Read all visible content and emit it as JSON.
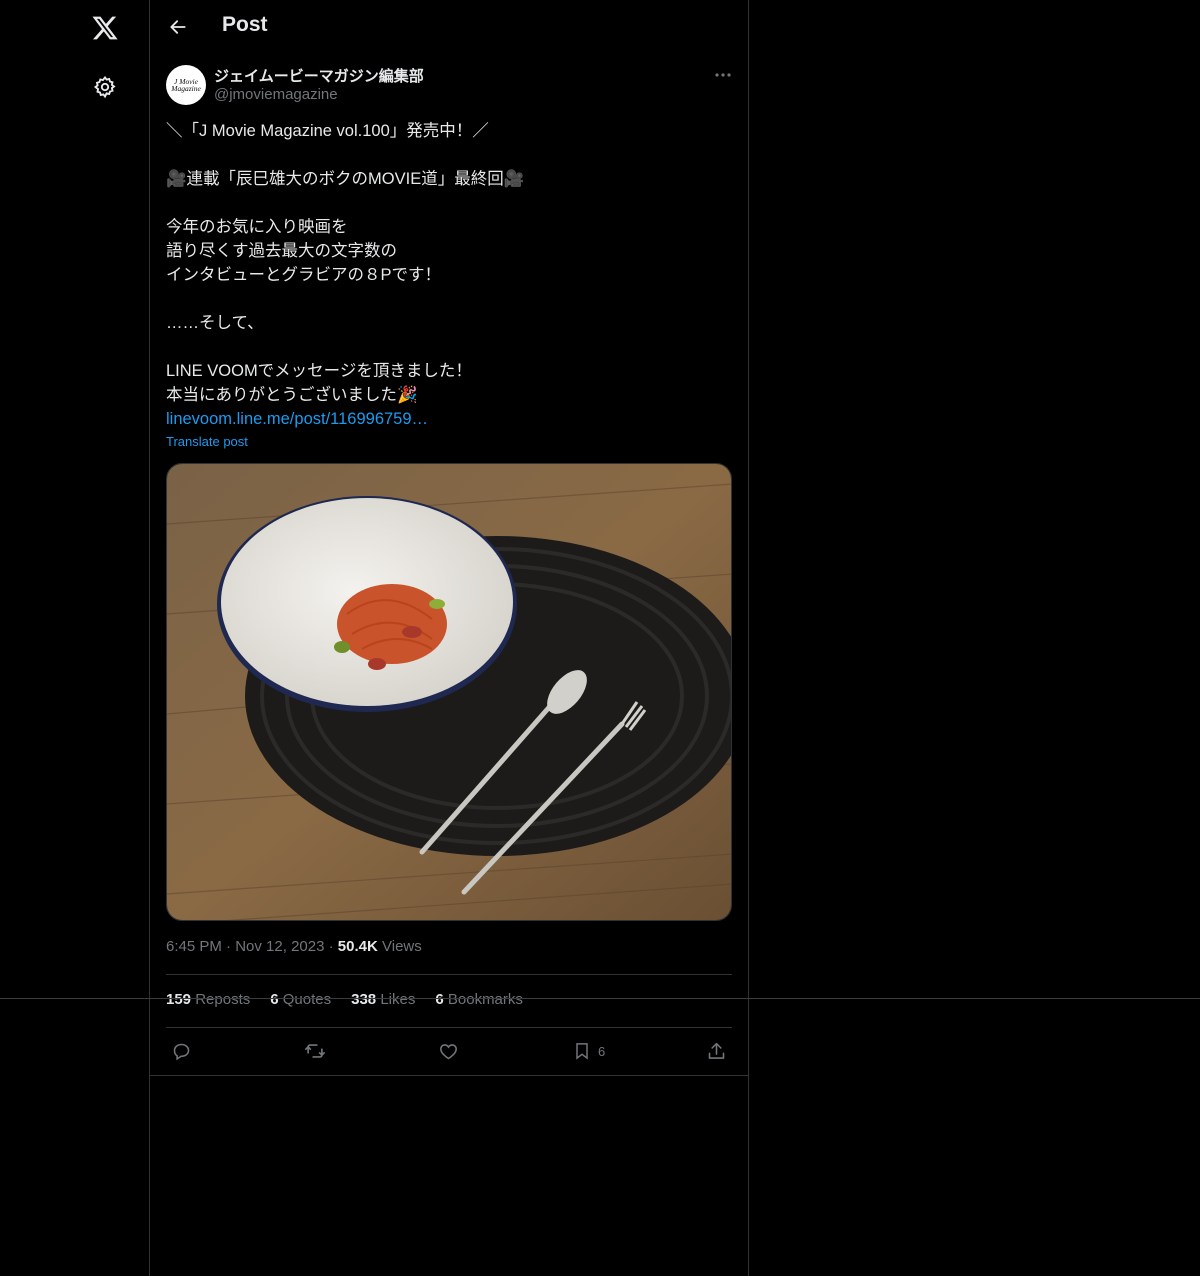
{
  "header": {
    "title": "Post"
  },
  "author": {
    "name": "ジェイムービーマガジン編集部",
    "handle": "@jmoviemagazine",
    "avatar_text": "J Movie Magazine"
  },
  "post": {
    "text": "＼「J Movie Magazine vol.100」発売中！／\n\n🎥連載「辰巳雄大のボクのMOVIE道」最終回🎥\n\n今年のお気に入り映画を\n語り尽くす過去最大の文字数の\nインタビューとグラビアの８Pです！\n\n……そして、\n\nLINE VOOMでメッセージを頂きました！\n本当にありがとうございました🎉",
    "link": "linevoom.line.me/post/116996759…",
    "translate": "Translate post",
    "image_alt": "Plate of spaghetti napolitan with spoon and fork on a dark placemat"
  },
  "meta": {
    "time": "6:45 PM",
    "date": "Nov 12, 2023",
    "views_count": "50.4K",
    "views_label": "Views",
    "sep": "·"
  },
  "stats": {
    "reposts_count": "159",
    "reposts_label": "Reposts",
    "quotes_count": "6",
    "quotes_label": "Quotes",
    "likes_count": "338",
    "likes_label": "Likes",
    "bookmarks_count": "6",
    "bookmarks_label": "Bookmarks"
  },
  "actions": {
    "bookmark_count": "6"
  },
  "icons": [
    "x-logo-icon",
    "gear-icon",
    "back-arrow-icon",
    "more-icon",
    "reply-icon",
    "repost-icon",
    "like-icon",
    "bookmark-icon",
    "share-icon"
  ],
  "colors": {
    "background": "#000000",
    "text": "#e7e9ea",
    "muted": "#71767b",
    "link": "#1d9bf0",
    "border": "#2f3336"
  }
}
